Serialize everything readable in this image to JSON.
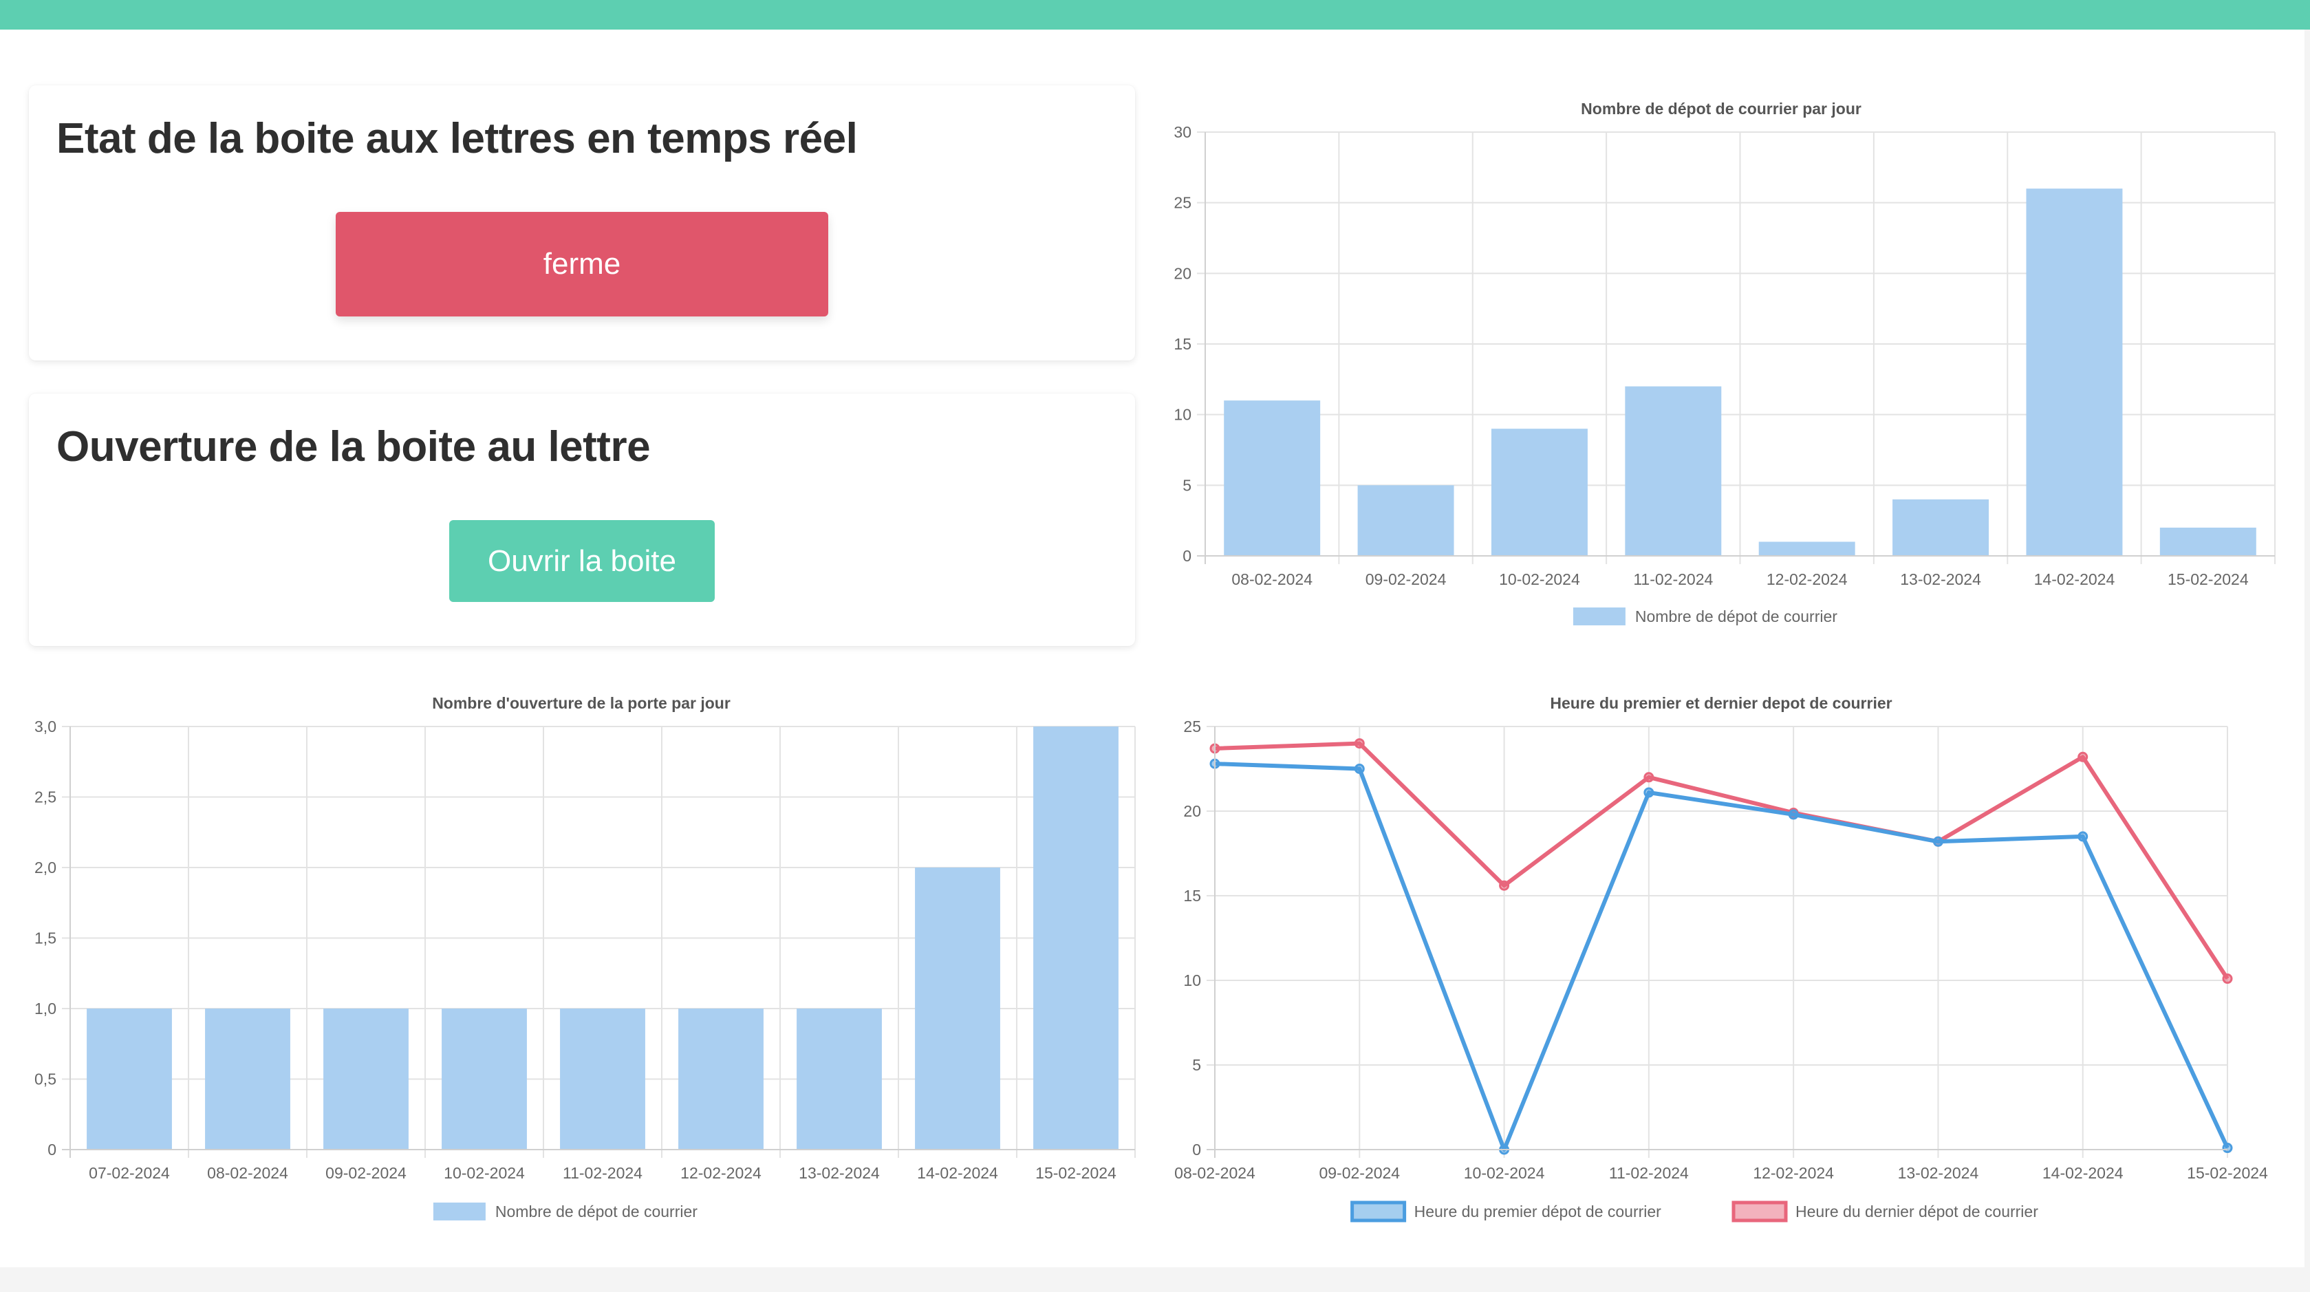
{
  "status_card": {
    "title": "Etat de la boite aux lettres en temps réel",
    "status_label": "ferme",
    "status_color": "#e0566b"
  },
  "open_card": {
    "title": "Ouverture de la boite au lettre",
    "button_label": "Ouvrir la boite",
    "button_color": "#5dcfb1"
  },
  "theme": {
    "accent": "#5dcfb1",
    "bar_color": "#aacff1",
    "line_blue": "#4b9de0",
    "line_red": "#e8667c"
  },
  "chart_data": [
    {
      "id": "deposits",
      "type": "bar",
      "title": "Nombre de dépot de courrier par jour",
      "categories": [
        "08-02-2024",
        "09-02-2024",
        "10-02-2024",
        "11-02-2024",
        "12-02-2024",
        "13-02-2024",
        "14-02-2024",
        "15-02-2024"
      ],
      "series": [
        {
          "name": "Nombre de dépot de courrier",
          "values": [
            11,
            5,
            9,
            12,
            1,
            4,
            26,
            2
          ],
          "color": "#aacff1"
        }
      ],
      "ylim": [
        0,
        30
      ],
      "yticks": [
        "0",
        "5",
        "10",
        "15",
        "20",
        "25",
        "30"
      ],
      "grid": true,
      "legend": "bottom"
    },
    {
      "id": "openings",
      "type": "bar",
      "title": "Nombre d'ouverture de la porte par jour",
      "categories": [
        "07-02-2024",
        "08-02-2024",
        "09-02-2024",
        "10-02-2024",
        "11-02-2024",
        "12-02-2024",
        "13-02-2024",
        "14-02-2024",
        "15-02-2024"
      ],
      "series": [
        {
          "name": "Nombre de dépot de courrier",
          "values": [
            1,
            1,
            1,
            1,
            1,
            1,
            1,
            2,
            3
          ],
          "color": "#aacff1"
        }
      ],
      "ylim": [
        0,
        3
      ],
      "yticks": [
        "0",
        "0,5",
        "1,0",
        "1,5",
        "2,0",
        "2,5",
        "3,0"
      ],
      "grid": true,
      "legend": "bottom"
    },
    {
      "id": "hours",
      "type": "line",
      "title": "Heure du premier et dernier depot de courrier",
      "categories": [
        "08-02-2024",
        "09-02-2024",
        "10-02-2024",
        "11-02-2024",
        "12-02-2024",
        "13-02-2024",
        "14-02-2024",
        "15-02-2024"
      ],
      "series": [
        {
          "name": "Heure du premier dépot de courrier",
          "values": [
            22.8,
            22.5,
            0,
            21.1,
            19.8,
            18.2,
            18.5,
            0.1
          ],
          "color": "#4b9de0"
        },
        {
          "name": "Heure du dernier dépot de courrier",
          "values": [
            23.7,
            24,
            15.6,
            22,
            19.9,
            18.2,
            23.2,
            10.1
          ],
          "color": "#e8667c"
        }
      ],
      "ylim": [
        0,
        25
      ],
      "yticks": [
        "0",
        "5",
        "10",
        "15",
        "20",
        "25"
      ],
      "grid": true,
      "legend": "bottom"
    }
  ]
}
